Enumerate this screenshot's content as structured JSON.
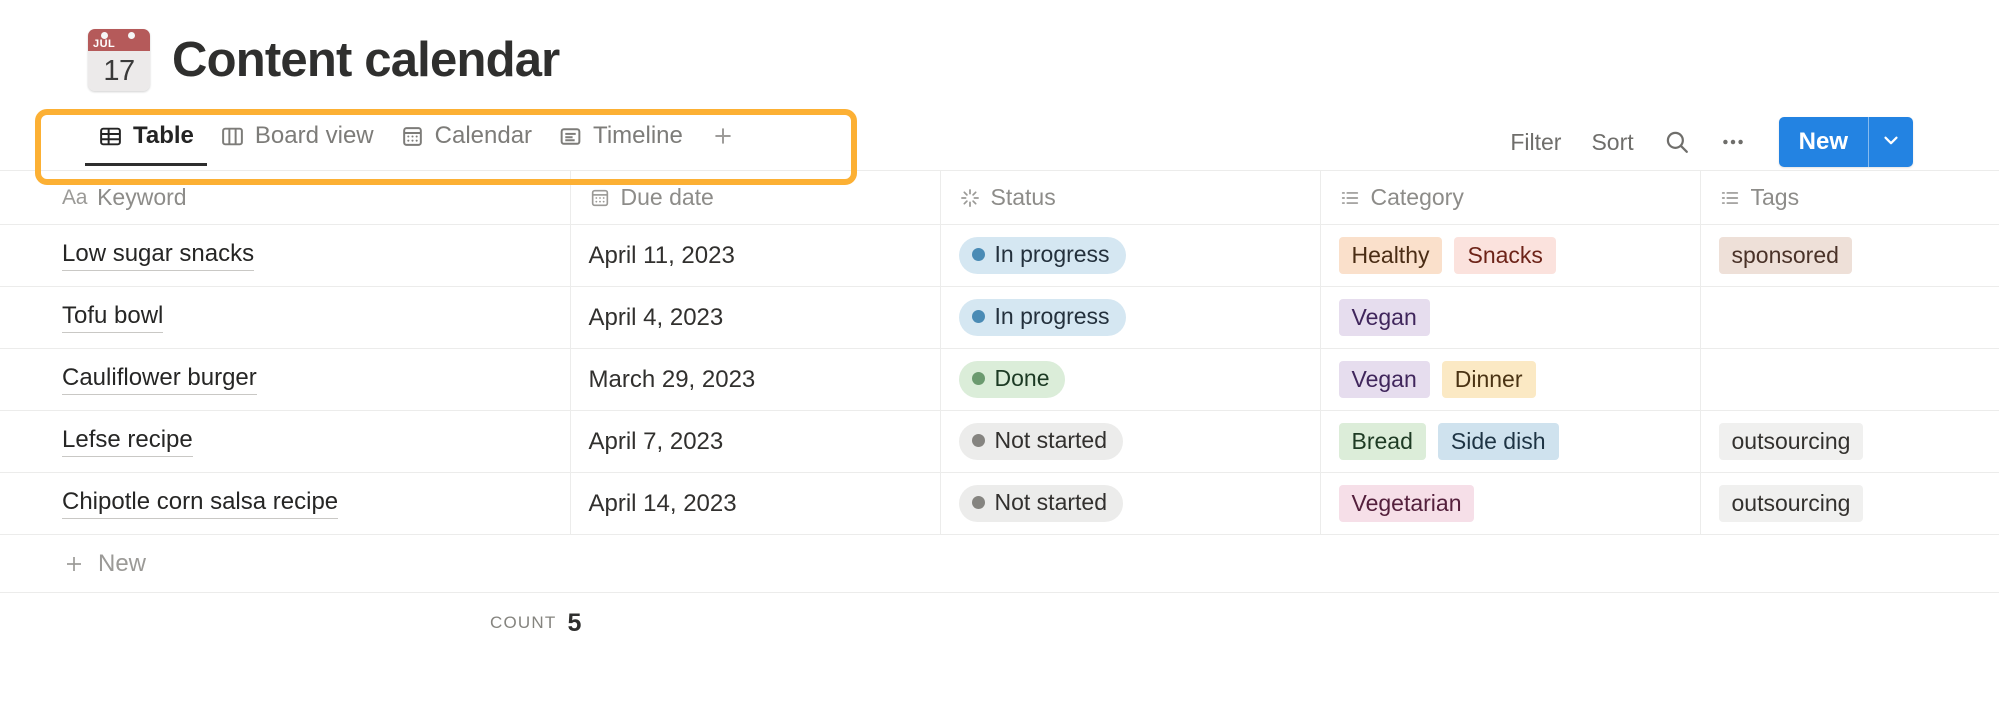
{
  "header": {
    "emoji": {
      "name": "calendar-emoji",
      "month": "JUL",
      "day": "17"
    },
    "title": "Content calendar"
  },
  "tabs": [
    {
      "label": "Table",
      "icon": "table-icon",
      "active": true
    },
    {
      "label": "Board view",
      "icon": "board-icon",
      "active": false
    },
    {
      "label": "Calendar",
      "icon": "calendar-icon",
      "active": false
    },
    {
      "label": "Timeline",
      "icon": "timeline-icon",
      "active": false
    }
  ],
  "tab_add": {
    "label": "+",
    "icon": "plus-icon"
  },
  "toolbar": {
    "filter_label": "Filter",
    "sort_label": "Sort",
    "search_icon": "search-icon",
    "more_icon": "ellipsis-icon",
    "new_label": "New",
    "new_caret_icon": "chevron-down-icon",
    "accent_color": "#2383e2"
  },
  "highlight": {
    "color": "#fcb034"
  },
  "table": {
    "columns": [
      {
        "key": "keyword",
        "label": "Keyword",
        "icon": "title-text-icon"
      },
      {
        "key": "due_date",
        "label": "Due date",
        "icon": "date-icon"
      },
      {
        "key": "status",
        "label": "Status",
        "icon": "status-spinner-icon"
      },
      {
        "key": "category",
        "label": "Category",
        "icon": "multi-select-icon"
      },
      {
        "key": "tags",
        "label": "Tags",
        "icon": "multi-select-icon"
      }
    ],
    "rows": [
      {
        "keyword": "Low sugar snacks",
        "due_date": "April 11, 2023",
        "status": {
          "label": "In progress",
          "bg": "#d5e7f2",
          "fg": "#23303c",
          "dot": "#4a8bb5"
        },
        "category": [
          {
            "label": "Healthy",
            "bg": "#fae0cb",
            "fg": "#4a2c14"
          },
          {
            "label": "Snacks",
            "bg": "#fbe2dd",
            "fg": "#6d2318"
          }
        ],
        "tags": [
          {
            "label": "sponsored",
            "bg": "#eee0d8",
            "fg": "#4a3228"
          }
        ]
      },
      {
        "keyword": "Tofu bowl",
        "due_date": "April 4, 2023",
        "status": {
          "label": "In progress",
          "bg": "#d5e7f2",
          "fg": "#23303c",
          "dot": "#4a8bb5"
        },
        "category": [
          {
            "label": "Vegan",
            "bg": "#e6ddee",
            "fg": "#40265c"
          }
        ],
        "tags": []
      },
      {
        "keyword": "Cauliflower burger",
        "due_date": "March 29, 2023",
        "status": {
          "label": "Done",
          "bg": "#dbedd9",
          "fg": "#1c3a24",
          "dot": "#6b9a6f"
        },
        "category": [
          {
            "label": "Vegan",
            "bg": "#e6ddee",
            "fg": "#40265c"
          },
          {
            "label": "Dinner",
            "bg": "#fbe9c4",
            "fg": "#4a3313"
          }
        ],
        "tags": []
      },
      {
        "keyword": "Lefse recipe",
        "due_date": "April 7, 2023",
        "status": {
          "label": "Not started",
          "bg": "#ececeb",
          "fg": "#32302e",
          "dot": "#858480"
        },
        "category": [
          {
            "label": "Bread",
            "bg": "#dcedd9",
            "fg": "#1e3b24"
          },
          {
            "label": "Side dish",
            "bg": "#cfe2ee",
            "fg": "#1e3444"
          }
        ],
        "tags": [
          {
            "label": "outsourcing",
            "bg": "#f0f0ef",
            "fg": "#33312e"
          }
        ]
      },
      {
        "keyword": "Chipotle corn salsa recipe",
        "due_date": "April 14, 2023",
        "status": {
          "label": "Not started",
          "bg": "#ececeb",
          "fg": "#32302e",
          "dot": "#858480"
        },
        "category": [
          {
            "label": "Vegetarian",
            "bg": "#f6dfe8",
            "fg": "#54203c"
          }
        ],
        "tags": [
          {
            "label": "outsourcing",
            "bg": "#f0f0ef",
            "fg": "#33312e"
          }
        ]
      }
    ],
    "new_row_label": "New",
    "footer": {
      "count_label": "Count",
      "count_value": "5"
    }
  }
}
